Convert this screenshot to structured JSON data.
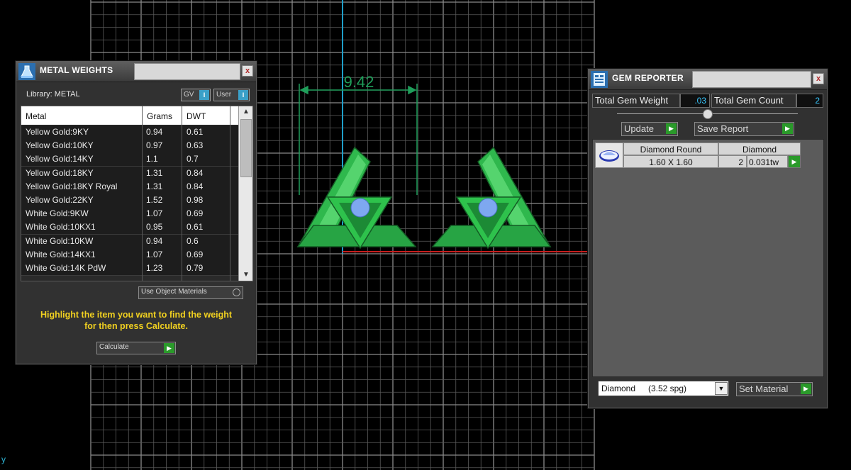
{
  "viewport": {
    "dimension_label": "9.42",
    "axis_label": "y",
    "colors": {
      "background": "#000000",
      "grid": "#6e6e6e",
      "x_axis": "#c81e1e",
      "y_axis": "#1e9ec8",
      "dimension": "#1f9e5a",
      "model": "#2ab84a",
      "gem": "#7ea8f0"
    }
  },
  "metal_weights": {
    "title": "METAL WEIGHTS",
    "close_label": "x",
    "library_label": "Library: METAL",
    "toggle_gv": "GV",
    "toggle_user": "User",
    "toggle_mark": "I",
    "columns": [
      "Metal",
      "Grams",
      "DWT"
    ],
    "rows": [
      {
        "metal": "Yellow Gold:9KY",
        "grams": "0.94",
        "dwt": "0.61"
      },
      {
        "metal": "Yellow Gold:10KY",
        "grams": "0.97",
        "dwt": "0.63"
      },
      {
        "metal": "Yellow Gold:14KY",
        "grams": "1.1",
        "dwt": "0.7"
      },
      {
        "metal": "Yellow Gold:18KY",
        "grams": "1.31",
        "dwt": "0.84"
      },
      {
        "metal": "Yellow Gold:18KY Royal",
        "grams": "1.31",
        "dwt": "0.84"
      },
      {
        "metal": "Yellow Gold:22KY",
        "grams": "1.52",
        "dwt": "0.98"
      },
      {
        "metal": "White Gold:9KW",
        "grams": "1.07",
        "dwt": "0.69"
      },
      {
        "metal": "White Gold:10KX1",
        "grams": "0.95",
        "dwt": "0.61"
      },
      {
        "metal": "White Gold:10KW",
        "grams": "0.94",
        "dwt": "0.6"
      },
      {
        "metal": "White Gold:14KX1",
        "grams": "1.07",
        "dwt": "0.69"
      },
      {
        "metal": "White Gold:14K PdW",
        "grams": "1.23",
        "dwt": "0.79"
      }
    ],
    "scroll_up": "▲",
    "scroll_down": "▼",
    "use_object_materials": "Use Object Materials",
    "hint_line1": "Highlight the item you want to find the weight",
    "hint_line2": "for then press Calculate.",
    "calculate_label": "Calculate",
    "play_glyph": "▶"
  },
  "gem_reporter": {
    "title": "GEM REPORTER",
    "close_label": "x",
    "total_weight_label": "Total Gem Weight",
    "total_weight_value": ".03",
    "total_count_label": "Total Gem Count",
    "total_count_value": "2",
    "update_label": "Update",
    "save_report_label": "Save Report",
    "play_glyph": "▶",
    "gem_row": {
      "shape": "Diamond Round",
      "material": "Diamond",
      "size": "1.60 X 1.60",
      "count": "2",
      "weight": "0.031tw"
    },
    "material_select": {
      "name": "Diamond",
      "value": "(3.52 spg)"
    },
    "dropdown_arrow": "▼",
    "set_material_label": "Set Material"
  }
}
